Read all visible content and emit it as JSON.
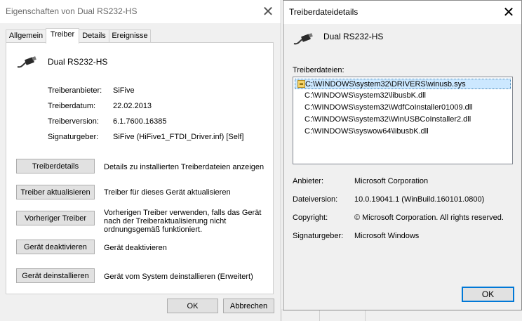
{
  "properties_dialog": {
    "title": "Eigenschaften von Dual RS232-HS",
    "tabs": [
      "Allgemein",
      "Treiber",
      "Details",
      "Ereignisse"
    ],
    "device_name": "Dual RS232-HS",
    "fields": [
      {
        "label": "Treiberanbieter:",
        "value": "SiFive"
      },
      {
        "label": "Treiberdatum:",
        "value": "22.02.2013"
      },
      {
        "label": "Treiberversion:",
        "value": "6.1.7600.16385"
      },
      {
        "label": "Signaturgeber:",
        "value": "SiFive (HiFive1_FTDI_Driver.inf) [Self]"
      }
    ],
    "actions": [
      {
        "button": "Treiberdetails",
        "description": "Details zu installierten Treiberdateien anzeigen"
      },
      {
        "button": "Treiber aktualisieren",
        "description": "Treiber für dieses Gerät aktualisieren"
      },
      {
        "button": "Vorheriger Treiber",
        "description": "Vorherigen Treiber verwenden, falls das Gerät nach der Treiberaktualisierung nicht ordnungsgemäß funktioniert."
      },
      {
        "button": "Gerät deaktivieren",
        "description": "Gerät deaktivieren"
      },
      {
        "button": "Gerät deinstallieren",
        "description": "Gerät vom System deinstallieren (Erweitert)"
      }
    ],
    "ok_label": "OK",
    "cancel_label": "Abbrechen"
  },
  "details_dialog": {
    "title": "Treiberdateidetails",
    "device_name": "Dual RS232-HS",
    "files_label": "Treiberdateien:",
    "files": [
      "C:\\WINDOWS\\system32\\DRIVERS\\winusb.sys",
      "C:\\WINDOWS\\system32\\libusbK.dll",
      "C:\\WINDOWS\\system32\\WdfCoInstaller01009.dll",
      "C:\\WINDOWS\\system32\\WinUSBCoInstaller2.dll",
      "C:\\WINDOWS\\syswow64\\libusbK.dll"
    ],
    "selected_file_index": 0,
    "info": [
      {
        "label": "Anbieter:",
        "value": "Microsoft Corporation"
      },
      {
        "label": "Dateiversion:",
        "value": "10.0.19041.1 (WinBuild.160101.0800)"
      },
      {
        "label": "Copyright:",
        "value": "© Microsoft Corporation. All rights reserved."
      },
      {
        "label": "Signaturgeber:",
        "value": "Microsoft Windows"
      }
    ],
    "ok_label": "OK"
  },
  "icons": {
    "close": "close-icon",
    "device": "usb-cable-icon",
    "file": "driver-file-icon"
  },
  "colors": {
    "selection": "#cce8ff",
    "default_button_border": "#0078d7"
  }
}
